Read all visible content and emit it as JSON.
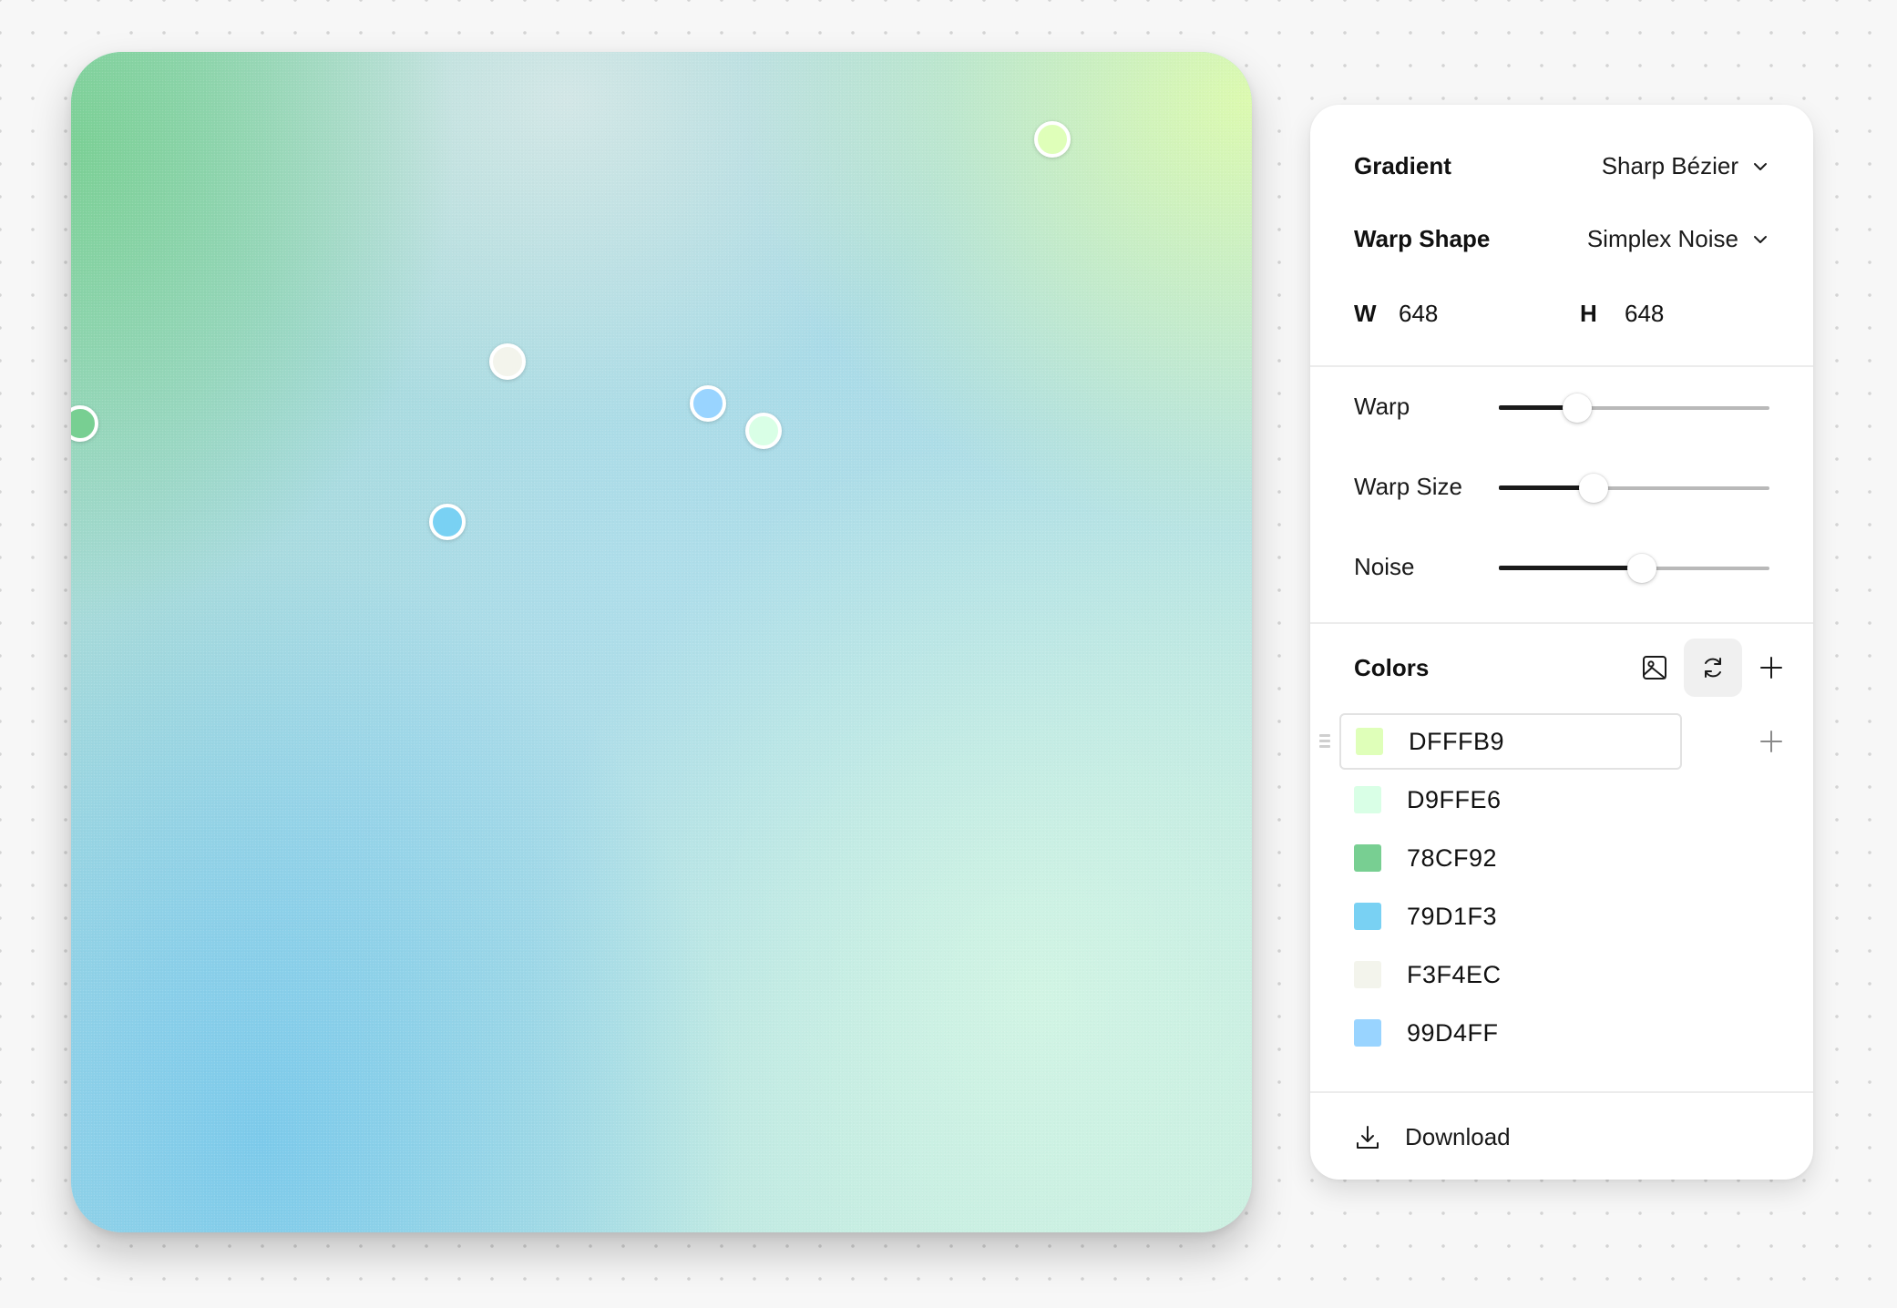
{
  "canvas": {
    "gradient_stops": [
      {
        "color": "#78CF92"
      },
      {
        "color": "#D9FFE6"
      },
      {
        "color": "#DFFFB9"
      },
      {
        "color": "#79D1F3"
      },
      {
        "color": "#F3F4EC"
      },
      {
        "color": "#99D4FF"
      }
    ],
    "handles": [
      {
        "name": "handle-dfffb9",
        "color": "#DFFFB9"
      },
      {
        "name": "handle-f3f4ec",
        "color": "#F3F4EC"
      },
      {
        "name": "handle-99d4ff",
        "color": "#99D4FF"
      },
      {
        "name": "handle-d9ffe6",
        "color": "#D9FFE6"
      },
      {
        "name": "handle-79d1f3",
        "color": "#79D1F3"
      },
      {
        "name": "handle-78cf92",
        "color": "#78CF92"
      }
    ]
  },
  "panel": {
    "gradient": {
      "label": "Gradient",
      "value": "Sharp Bézier"
    },
    "warp_shape": {
      "label": "Warp Shape",
      "value": "Simplex Noise"
    },
    "size": {
      "w_label": "W",
      "w_value": "648",
      "h_label": "H",
      "h_value": "648"
    },
    "sliders": [
      {
        "label": "Warp",
        "value": 0.29
      },
      {
        "label": "Warp Size",
        "value": 0.35
      },
      {
        "label": "Noise",
        "value": 0.53
      }
    ],
    "colors": {
      "title": "Colors",
      "icons": [
        "image-icon",
        "refresh-icon",
        "plus-icon"
      ],
      "items": [
        {
          "hex": "DFFFB9",
          "swatch": "#DFFFB9"
        },
        {
          "hex": "D9FFE6",
          "swatch": "#D9FFE6"
        },
        {
          "hex": "78CF92",
          "swatch": "#78CF92"
        },
        {
          "hex": "79D1F3",
          "swatch": "#79D1F3"
        },
        {
          "hex": "F3F4EC",
          "swatch": "#F3F4EC"
        },
        {
          "hex": "99D4FF",
          "swatch": "#99D4FF"
        }
      ]
    },
    "download": {
      "label": "Download",
      "icon": "download-icon"
    }
  }
}
